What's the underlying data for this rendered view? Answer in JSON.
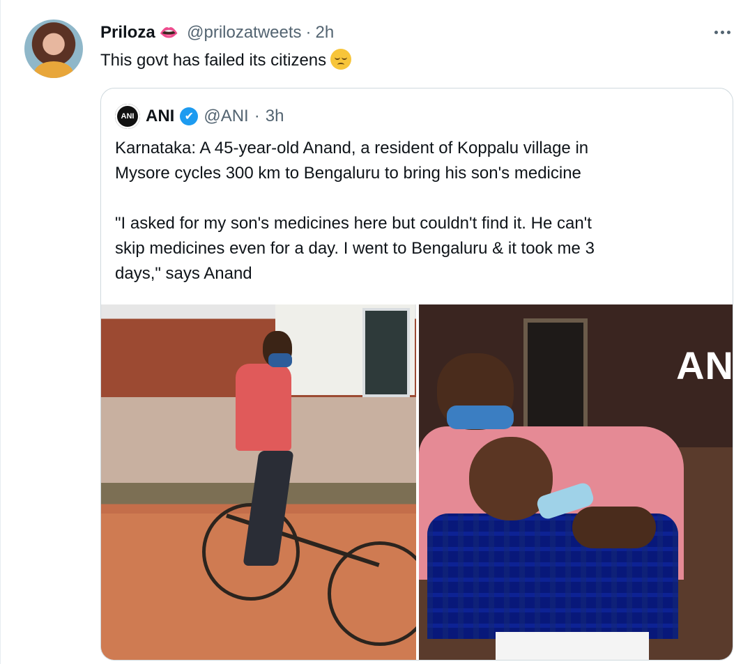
{
  "tweet": {
    "author": {
      "name": "Priloza",
      "name_emoji": "👄",
      "handle": "@prilozatweets",
      "separator": "·",
      "time": "2h"
    },
    "text": "This govt has failed its citizens",
    "text_emoji": "pensive-face-emoji",
    "more_icon": "ellipsis-icon"
  },
  "quoted_tweet": {
    "author": {
      "name": "ANI",
      "avatar_text": "ANI",
      "verified_icon": "✔",
      "handle": "@ANI",
      "separator": "·",
      "time": "3h"
    },
    "text": "Karnataka: A 45-year-old Anand, a resident of Koppalu village in\nMysore cycles 300 km to Bengaluru to bring his son's medicine\n\n\"I asked for my son's medicines here but couldn't find it. He can't\nskip medicines even for a day. I went to Bengaluru & it took me 3\ndays,\" says Anand",
    "media": {
      "photo_2_watermark": "AN"
    }
  }
}
